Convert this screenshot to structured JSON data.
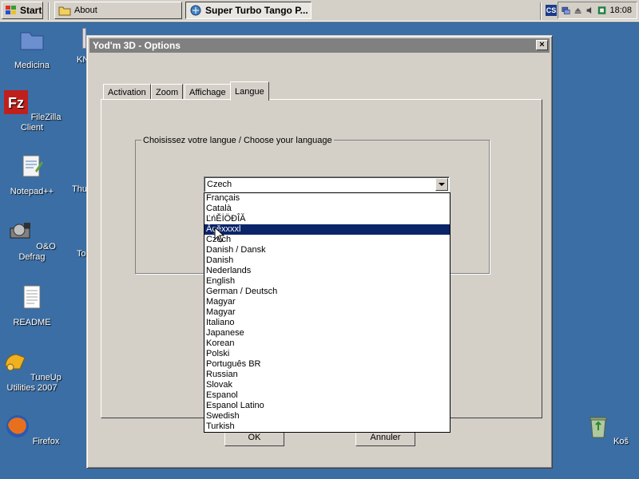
{
  "taskbar": {
    "start_label": "Start",
    "tasks": [
      {
        "label": "About",
        "icon": "folder-icon"
      },
      {
        "label": "Super Turbo Tango P...",
        "icon": "app-icon",
        "active": true
      }
    ],
    "quicklaunch_label": "CS",
    "clock": "18:08"
  },
  "desktop": {
    "icons": [
      {
        "label": "Medicina",
        "icon": "folder-icon"
      },
      {
        "label": "FileZilla Client",
        "icon": "filezilla-icon"
      },
      {
        "label": "Notepad++",
        "icon": "notepad-icon"
      },
      {
        "label": "O&O Defrag",
        "icon": "defrag-icon"
      },
      {
        "label": "README",
        "icon": "document-icon"
      },
      {
        "label": "TuneUp Utilities 2007",
        "icon": "tuneup-icon"
      },
      {
        "label": "Firefox",
        "icon": "firefox-icon"
      },
      {
        "label": "Koš",
        "icon": "recycle-bin-icon"
      }
    ],
    "partial_labels": [
      "KN",
      "Thu",
      "To"
    ]
  },
  "window": {
    "title": "Yod'm 3D - Options",
    "tabs": [
      "Activation",
      "Zoom",
      "Affichage",
      "Langue"
    ],
    "active_tab": "Langue",
    "group_label": "Choisissez votre langue / Choose your language",
    "language_select": {
      "value": "Czech",
      "options": [
        "Français",
        "Català",
        "ĽńĚİÖĐÎĂ",
        "Ăçěxxxxl",
        "Czech",
        "Danish / Dansk",
        "Danish",
        "Nederlands",
        "English",
        "German / Deutsch",
        "Magyar",
        "Magyar",
        "Italiano",
        "Japanese",
        "Korean",
        "Polski",
        "Português BR",
        "Russian",
        "Slovak",
        "Espanol",
        "Espanol Latino",
        "Swedish",
        "Turkish"
      ],
      "highlighted_index": 3
    },
    "ok_label": "OK",
    "cancel_label": "Annuler",
    "close_label": "×"
  },
  "colors": {
    "desktop": "#3a6ea5",
    "selection": "#0a246a",
    "title_inactive": "#808080"
  }
}
